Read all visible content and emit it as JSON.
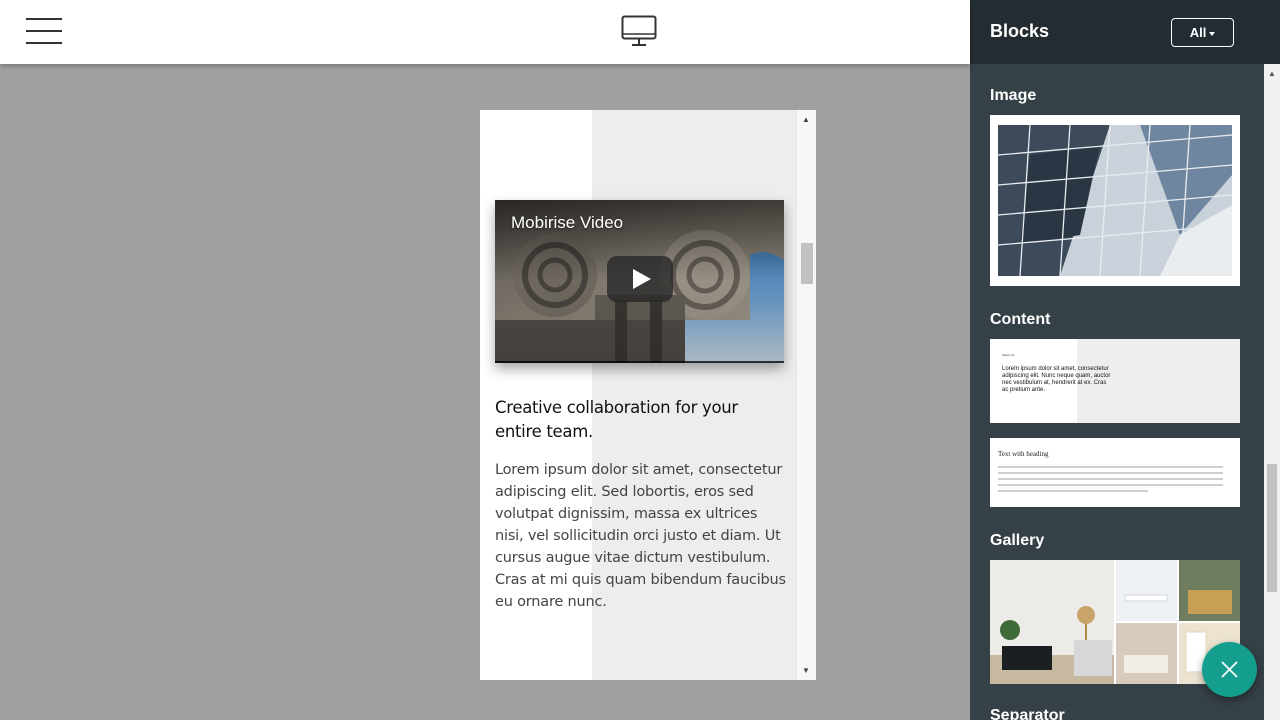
{
  "sidebar": {
    "title": "Blocks",
    "filter_label": "All",
    "sections": {
      "image": "Image",
      "content": "Content",
      "gallery": "Gallery",
      "separator": "Separator"
    },
    "content_thumb1": {
      "small": "About Us",
      "text": "Lorem ipsum dolor sit amet, consectetur adipiscing elit. Nunc neque quam, auctor nec vestibulum at, hendrerit at ex. Cras ac pretium ante."
    },
    "content_thumb2": {
      "heading": "Text with heading"
    }
  },
  "preview": {
    "video_title": "Mobirise Video",
    "heading": "Creative collaboration for your entire team.",
    "text": "Lorem ipsum dolor sit amet, consectetur adipiscing elit. Sed lobortis, eros sed volutpat dignissim, massa ex ultrices nisi, vel sollicitudin orci justo et diam. Ut cursus augue vitae dictum vestibulum. Cras at mi quis quam bibendum faucibus eu ornare nunc."
  },
  "colors": {
    "accent": "#149e8e",
    "sidebar_bg": "#354047",
    "sidebar_header_bg": "#232c32",
    "canvas_bg": "#a0a0a0"
  },
  "icons": {
    "menu": "hamburger-menu-icon",
    "device": "desktop-monitor-icon",
    "play": "play-icon",
    "close": "close-icon",
    "caret": "caret-down-icon"
  }
}
